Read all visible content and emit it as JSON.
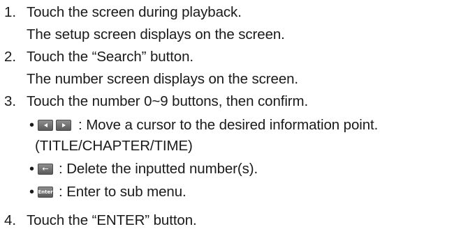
{
  "steps": [
    {
      "number": "1.",
      "instruction": "Touch the screen during playback.",
      "result": "The setup screen displays on the screen."
    },
    {
      "number": "2.",
      "instruction": "Touch the “Search” button.",
      "result": "The number screen displays on the screen."
    },
    {
      "number": "3.",
      "instruction": "Touch the number 0~9 buttons, then confirm."
    },
    {
      "number": "4.",
      "instruction": "Touch the “ENTER” button."
    }
  ],
  "bullets": [
    {
      "text": ": Move a cursor to the desired information point.",
      "continuation": "(TITLE/CHAPTER/TIME)",
      "icons": [
        "left-arrow-key-icon",
        "right-arrow-key-icon"
      ]
    },
    {
      "text": ": Delete the inputted number(s).",
      "icons": [
        "backspace-key-icon"
      ]
    },
    {
      "text": ": Enter to sub menu.",
      "icons": [
        "enter-key-icon"
      ],
      "enter_label": "Enter"
    }
  ],
  "bullet_symbol": "•",
  "back_arrow_glyph": "←"
}
